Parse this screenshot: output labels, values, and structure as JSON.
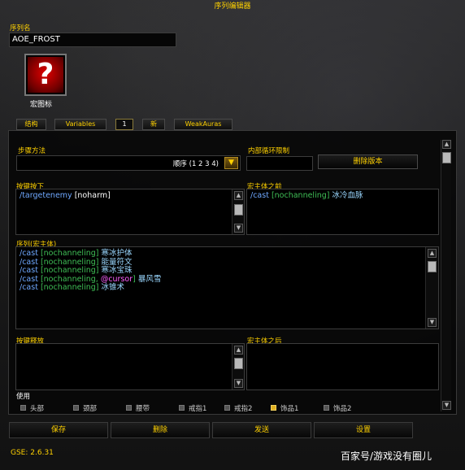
{
  "window": {
    "title": "序列编辑器"
  },
  "sequence_name": {
    "label": "序列名",
    "value": "AOE_FROST"
  },
  "macro_icon": {
    "label": "宏图标",
    "glyph": "?"
  },
  "tabs": [
    {
      "label": "结构"
    },
    {
      "label": "Variables"
    },
    {
      "label": "1"
    },
    {
      "label": "新"
    },
    {
      "label": "WeakAuras"
    }
  ],
  "step_method": {
    "label": "步骤方法",
    "value": "顺序 (1 2 3 4)"
  },
  "inner_loop": {
    "label": "内部循环限制",
    "value": ""
  },
  "delete_version_button": "删除版本",
  "key_press": {
    "label": "按键按下",
    "lines": [
      {
        "kw": "/targetenemy",
        "rest": " [noharm]"
      }
    ]
  },
  "pre_macro": {
    "label": "宏主体之前",
    "lines": [
      {
        "kw": "/cast",
        "cond": " [nochanneling]",
        "spell": " 冰冷血脉"
      }
    ]
  },
  "sequence_body": {
    "label": "序列(宏主体)",
    "lines": [
      {
        "kw": "/cast",
        "cond": " [nochanneling]",
        "spell": " 寒冰护体"
      },
      {
        "kw": "/cast",
        "cond": " [nochanneling]",
        "spell": " 能量符文"
      },
      {
        "kw": "/cast",
        "cond": " [nochanneling]",
        "spell": " 寒冰宝珠"
      },
      {
        "kw": "/cast",
        "cond": " [nochanneling, ",
        "cur": "@cursor",
        "cond2": "]",
        "spell": " 暴风雪"
      },
      {
        "kw": "/cast",
        "cond": " [nochanneling]",
        "spell": " 冰锥术"
      }
    ]
  },
  "key_release": {
    "label": "按键释放"
  },
  "post_macro": {
    "label": "宏主体之后"
  },
  "use": {
    "label": "使用",
    "items": [
      {
        "label": "头部",
        "checked": false
      },
      {
        "label": "颈部",
        "checked": false
      },
      {
        "label": "腰带",
        "checked": false
      },
      {
        "label": "戒指1",
        "checked": false
      },
      {
        "label": "戒指2",
        "checked": false
      },
      {
        "label": "饰品1",
        "checked": true
      },
      {
        "label": "饰品2",
        "checked": false
      }
    ]
  },
  "buttons": {
    "save": "保存",
    "delete": "删除",
    "send": "发送",
    "settings": "设置"
  },
  "version": "GSE: 2.6.31",
  "watermark": "百家号/游戏没有圈儿",
  "colors": {
    "gold": "#ffd100",
    "keyword": "#6fa8ff",
    "condition": "#3fbf56",
    "spell": "#9ad7ff",
    "cursor": "#ff5fff"
  }
}
